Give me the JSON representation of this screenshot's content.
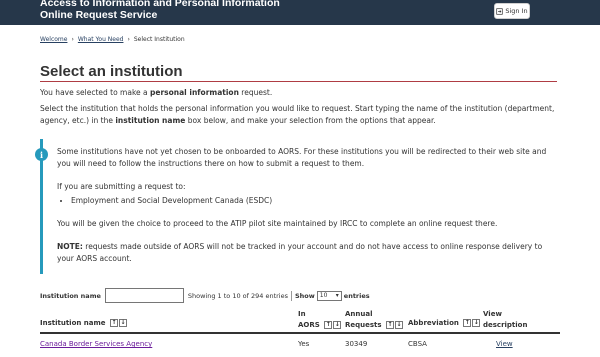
{
  "header": {
    "title_line1": "Access to Information and Personal Information",
    "title_line2": "Online Request Service",
    "signin_label": "Sign In"
  },
  "breadcrumb": {
    "items": [
      "Welcome",
      "What You Need",
      "Select Institution"
    ]
  },
  "page": {
    "title": "Select an institution",
    "intro_prefix": "You have selected to make a ",
    "intro_bold": "personal information",
    "intro_suffix": " request.",
    "instructions_a": "Select the institution that holds the personal information you would like to request. Start typing the name of the institution (department, agency, etc.) in the ",
    "instructions_bold": "institution name",
    "instructions_b": " box below, and make your selection from the options that appear."
  },
  "alert": {
    "para1": "Some institutions have not yet chosen to be onboarded to AORS. For these institutions you will be redirected to their web site and you will need to follow the instructions there on how to submit a request to them.",
    "para2": "If you are submitting a request to:",
    "list": [
      "Employment and Social Development Canada (ESDC)"
    ],
    "para3": "You will be given the choice to proceed to the ATIP pilot site maintained by IRCC to complete an online request there.",
    "note_label": "NOTE:",
    "note_text": " requests made outside of AORS will not be tracked in your account and do not have access to online response delivery to your AORS account."
  },
  "filter": {
    "label": "Institution name",
    "value": "",
    "placeholder": "",
    "entries_text": "Showing 1 to 10 of 294 entries",
    "show_label": "Show",
    "show_value": "10",
    "entries_label": "entries"
  },
  "table": {
    "columns": {
      "name": "Institution name",
      "in_aors_1": "In",
      "in_aors_2": "AORS",
      "requests_1": "Annual",
      "requests_2": "Requests",
      "abbreviation": "Abbreviation",
      "view_1": "View",
      "view_2": "description"
    },
    "rows": [
      {
        "name": "Canada Border Services Agency",
        "in_aors": "Yes",
        "requests": "30349",
        "abbreviation": "CBSA",
        "view": "View"
      }
    ]
  },
  "colors": {
    "header_bg": "#26374a",
    "title_rule": "#af3c43",
    "alert_accent": "#269abc",
    "visited_link": "#6a1b9a"
  }
}
